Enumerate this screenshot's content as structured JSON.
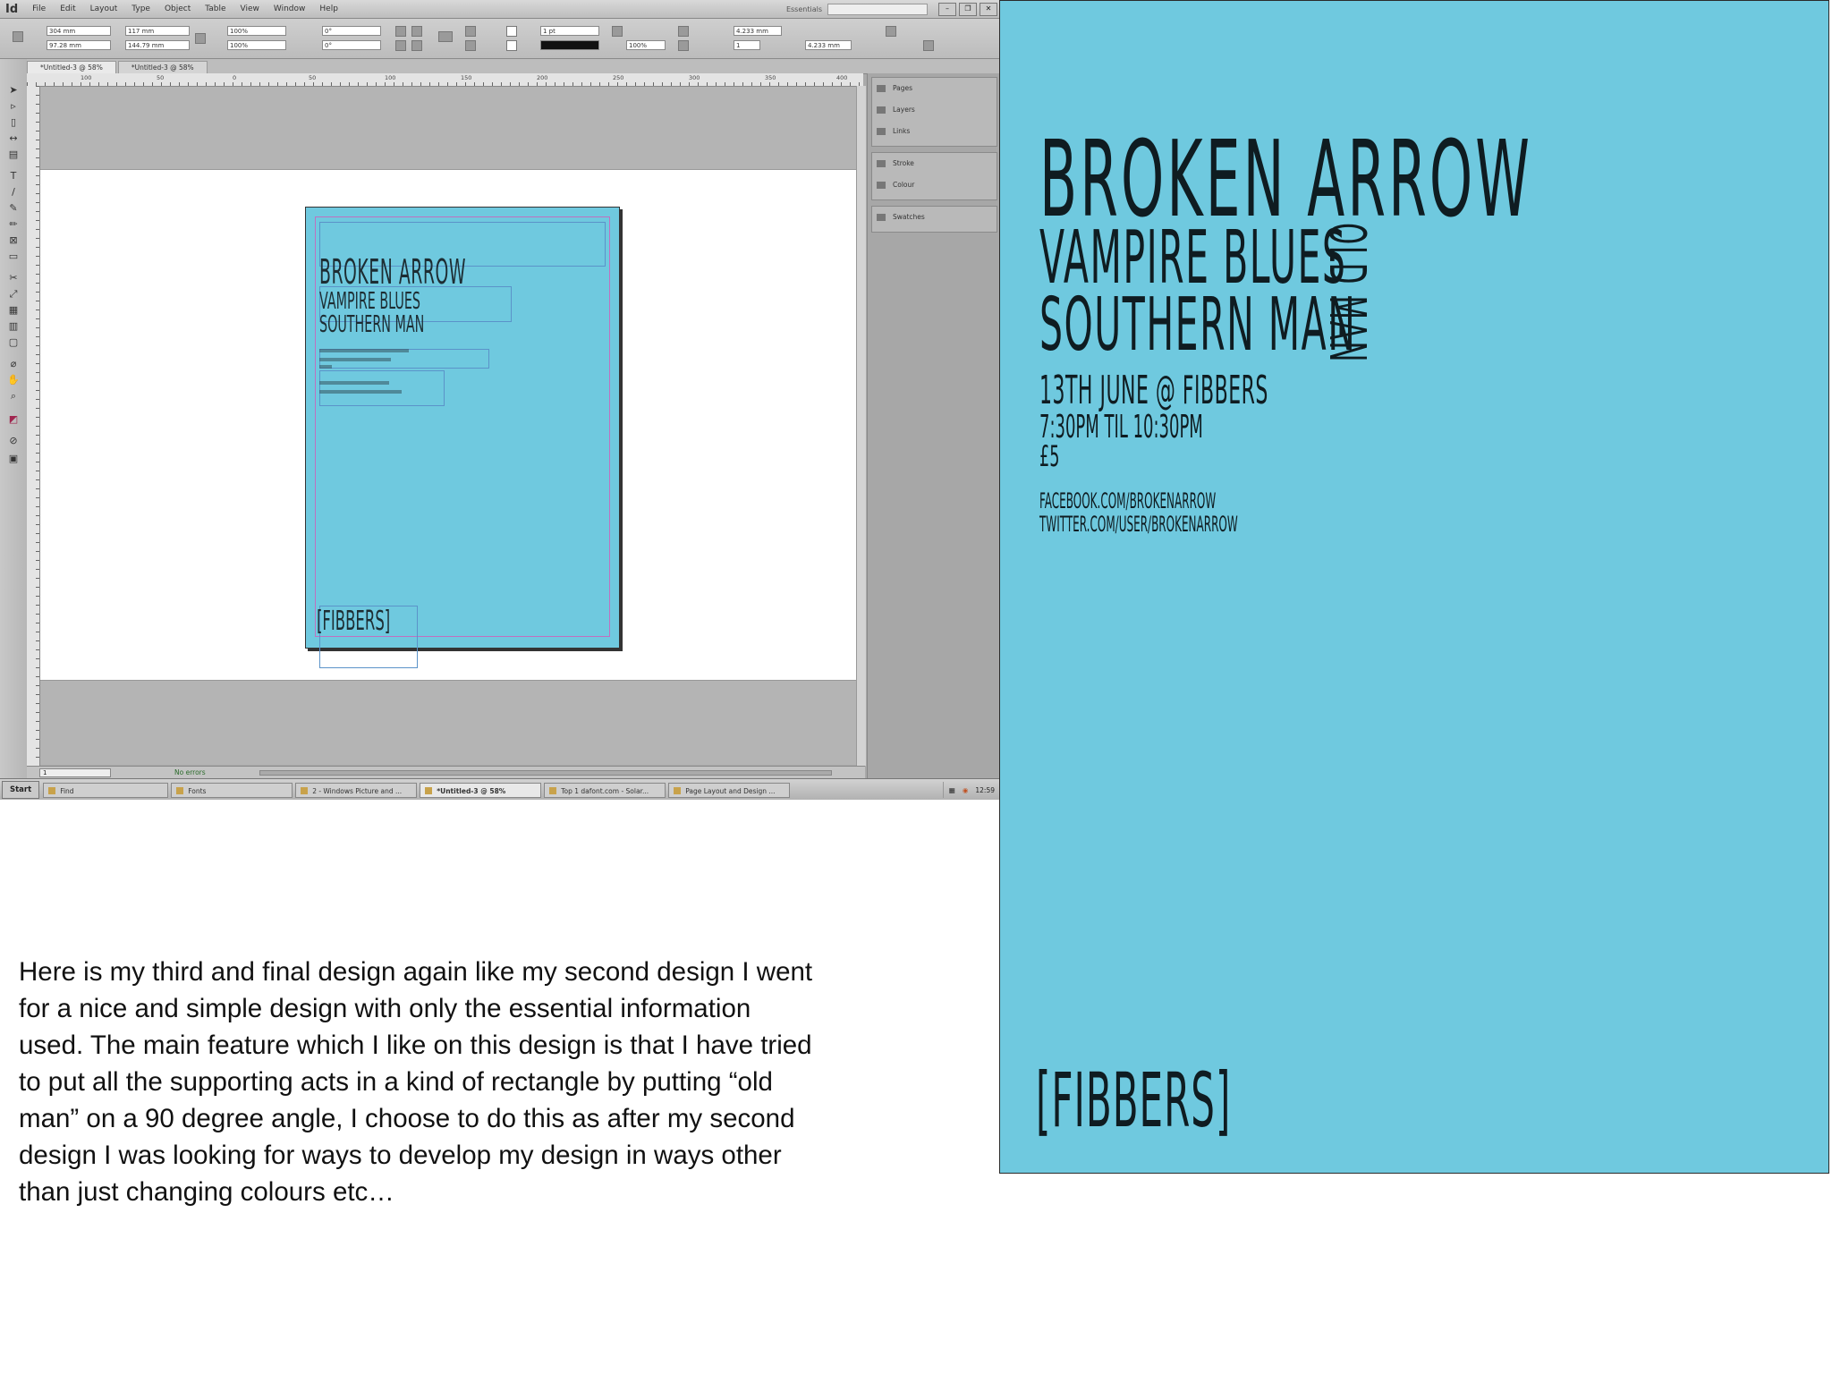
{
  "app": {
    "logo": "Id",
    "menu": [
      "File",
      "Edit",
      "Layout",
      "Type",
      "Object",
      "Table",
      "View",
      "Window",
      "Help"
    ],
    "workspace": "Essentials",
    "control_bar": {
      "x": "304 mm",
      "y": "97.28 mm",
      "w": "117 mm",
      "h": "144.79 mm",
      "scale_x": "100%",
      "scale_y": "100%",
      "angle": "0°",
      "shear": "0°",
      "stroke_weight": "1 pt",
      "opacity": "100%",
      "offset_1": "4.233 mm",
      "offset_2": "4.233 mm",
      "columns": "1"
    },
    "tabs": [
      "*Untitled-3 @ 58%",
      "*Untitled-3 @ 58%"
    ],
    "ruler_numbers": [
      "100",
      "50",
      "0",
      "50",
      "100",
      "150",
      "200",
      "250",
      "300",
      "350",
      "400"
    ],
    "thumbnail": {
      "title": "BROKEN ARROW",
      "act_1": "VAMPIRE BLUES",
      "act_2": "SOUTHERN MAN",
      "venue": "[FIBBERS]"
    },
    "panels": [
      "Pages",
      "Layers",
      "Links",
      "Stroke",
      "Colour",
      "Swatches"
    ],
    "status": {
      "page": "1",
      "style": "No errors"
    },
    "taskbar": {
      "start": "Start",
      "items": [
        "Find",
        "Fonts",
        "2 - Windows Picture and ...",
        "*Untitled-3 @ 58%",
        "Top 1 dafont.com - Solar...",
        "Page Layout and Design ..."
      ],
      "active_index": 3,
      "clock": "12:59"
    }
  },
  "description": "Here is my third and final design again like my second design I went for a nice and simple design with only the essential information used. The main feature which I like on this design is that I have tried to put all the supporting acts in a kind of rectangle by putting “old man” on a 90 degree angle, I choose to do this as after my second design I was looking for ways to develop my design in ways other than just changing colours etc…",
  "poster": {
    "background": "#6fc9df",
    "title": "BROKEN ARROW",
    "act_1": "VAMPIRE BLUES",
    "act_2": "SOUTHERN MAN",
    "vertical_act": "OLD MAN",
    "date": "13TH JUNE @ FIBBERS",
    "time": "7:30PM TIL 10:30PM",
    "price": "£5",
    "facebook": "FACEBOOK.COM/BROKENARROW",
    "twitter": "TWITTER.COM/USER/BROKENARROW",
    "venue": "[FIBBERS]"
  }
}
